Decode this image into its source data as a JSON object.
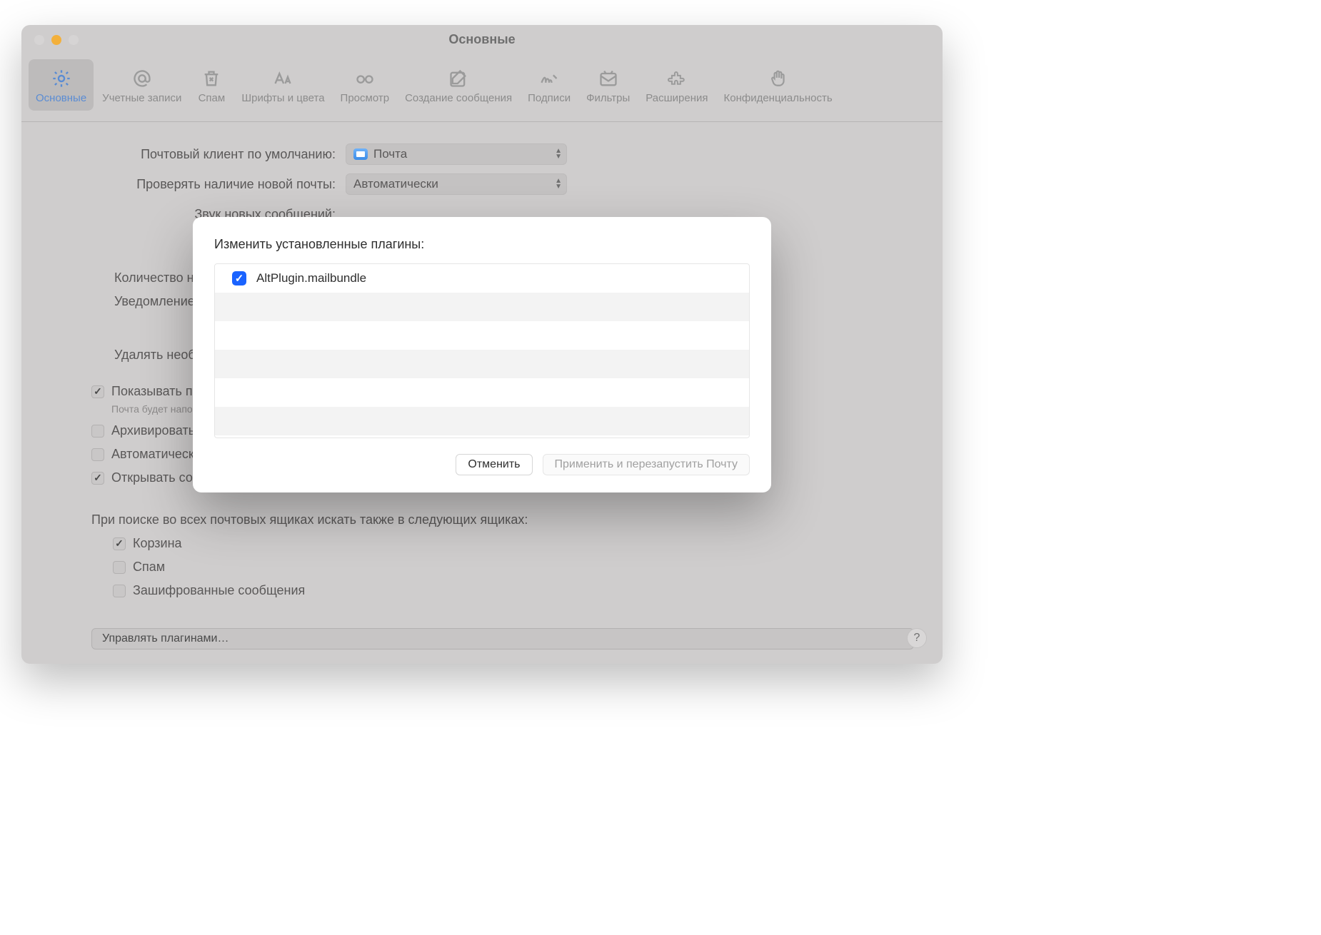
{
  "window": {
    "title": "Основные"
  },
  "tabs": [
    {
      "label": "Основные"
    },
    {
      "label": "Учетные записи"
    },
    {
      "label": "Спам"
    },
    {
      "label": "Шрифты и цвета"
    },
    {
      "label": "Просмотр"
    },
    {
      "label": "Создание сообщения"
    },
    {
      "label": "Подписи"
    },
    {
      "label": "Фильтры"
    },
    {
      "label": "Расширения"
    },
    {
      "label": "Конфиденциальность"
    }
  ],
  "form": {
    "default_client_label": "Почтовый клиент по умолчанию:",
    "default_client_value": "Почта",
    "check_mail_label": "Проверять наличие новой почты:",
    "check_mail_value": "Автоматически",
    "sound_label_partial": "Звук новых сообщений:",
    "unread_label_partial": "Количество не",
    "notify_label_partial": "Уведомление",
    "delete_label_partial": "Удалять необр",
    "show_label_partial": "Показывать пр",
    "show_helper_partial": "Почта будет напо",
    "archive_label_partial": "Архивировать",
    "auto_label_partial": "Автоматически",
    "splitview_label": "Открывать сообщения в Split View в полноэкранном режиме",
    "search_heading": "При поиске во всех почтовых ящиках искать также в следующих ящиках:",
    "search_opts": {
      "trash": "Корзина",
      "spam": "Спам",
      "encrypted": "Зашифрованные сообщения"
    },
    "manage_plugins_btn": "Управлять плагинами…",
    "help": "?"
  },
  "sheet": {
    "title": "Изменить установленные плагины:",
    "plugins": [
      {
        "name": "AltPlugin.mailbundle",
        "checked": true
      }
    ],
    "cancel": "Отменить",
    "apply": "Применить и перезапустить Почту"
  }
}
